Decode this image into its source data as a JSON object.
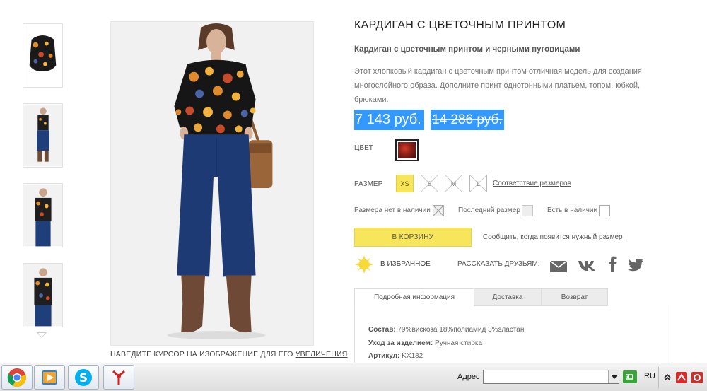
{
  "product": {
    "title": "КАРДИГАН С ЦВЕТОЧНЫМ ПРИНТОМ",
    "subtitle": "Кардиган с цветочным принтом и черными пуговицами",
    "description": "Этот хлопковый кардиган с цветочным принтом отличная модель для создания многослойного образа. Дополните принт однотонными платьем, топом, юбкой, брюками.",
    "price_new": "7 143 руб.",
    "price_old": "14 286 руб.",
    "color_label": "ЦВЕТ",
    "size_label": "РАЗМЕР",
    "sizes": [
      "XS",
      "S",
      "M",
      "L"
    ],
    "selected_size": "XS",
    "size_chart_link": "Соответствие размеров",
    "legend": {
      "not_available": "Размера нет в наличии",
      "last_size": "Последний размер",
      "in_stock": "Есть в наличии"
    },
    "cart_button": "В КОРЗИНУ",
    "notify_link": "Сообщить, когда появится нужный размер",
    "favorite": "В ИЗБРАННОЕ",
    "share": "РАССКАЗАТЬ ДРУЗЬЯМ:",
    "share_icons": [
      "mail-icon",
      "vk-icon",
      "facebook-icon",
      "twitter-icon"
    ]
  },
  "gallery": {
    "zoom_hint": "НАВЕДИТЕ КУРСОР НА ИЗОБРАЖЕНИЕ ДЛЯ ЕГО",
    "zoom_hint_link": "УВЕЛИЧЕНИЯ"
  },
  "tabs": [
    {
      "label": "Подробная информация",
      "active": true
    },
    {
      "label": "Доставка",
      "active": false
    },
    {
      "label": "Возврат",
      "active": false
    }
  ],
  "specs": [
    {
      "label": "Состав:",
      "value": "79%вискоза 18%полиамид 3%эластан"
    },
    {
      "label": "Уход за изделием:",
      "value": "Ручная стирка"
    },
    {
      "label": "Артикул:",
      "value": "KX182"
    }
  ],
  "taskbar": {
    "apps": [
      "chrome-icon",
      "media-player-icon",
      "skype-icon",
      "app-icon"
    ],
    "address_label": "Адрес",
    "address_value": "",
    "language": "RU"
  },
  "colors": {
    "accent_yellow": "#f7e55c",
    "selection_blue": "#3399ff"
  }
}
